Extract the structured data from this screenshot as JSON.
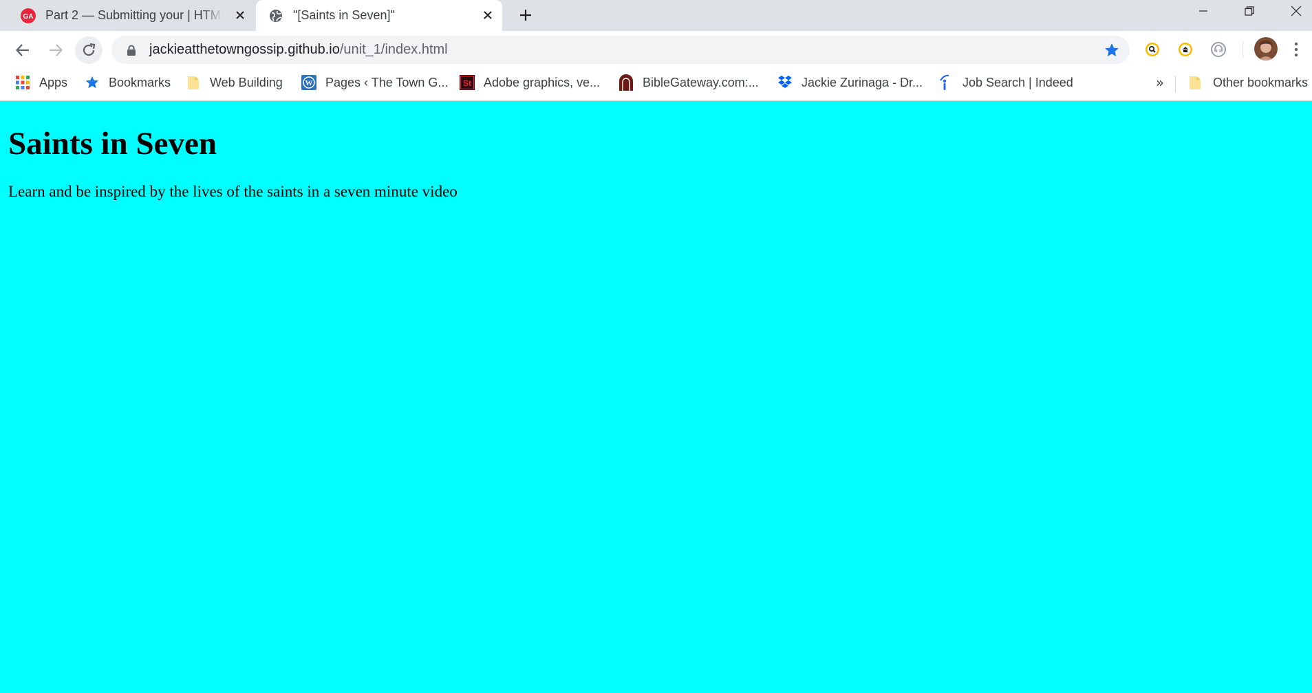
{
  "browser": {
    "tabs": [
      {
        "title": "Part 2 — Submitting your | HTML",
        "favicon": "ga-logo-icon",
        "active": false
      },
      {
        "title": "\"[Saints in Seven]\"",
        "favicon": "globe-icon",
        "active": true
      }
    ],
    "new_tab_label": "+",
    "address_bar": {
      "host": "jackieatthetowngossip.github.io",
      "path": "/unit_1/index.html"
    },
    "bookmarks": [
      {
        "label": "Apps",
        "icon": "apps-grid-icon"
      },
      {
        "label": "Bookmarks",
        "icon": "star-icon"
      },
      {
        "label": "Web Building",
        "icon": "folder-icon"
      },
      {
        "label": "Pages ‹ The Town G...",
        "icon": "wordpress-icon"
      },
      {
        "label": "Adobe graphics, ve...",
        "icon": "adobe-stock-icon"
      },
      {
        "label": "BibleGateway.com:...",
        "icon": "biblegateway-icon"
      },
      {
        "label": "Jackie Zurinaga - Dr...",
        "icon": "dropbox-icon"
      },
      {
        "label": "Job Search | Indeed",
        "icon": "indeed-icon"
      }
    ],
    "bookmarks_overflow": "»",
    "other_bookmarks": {
      "label": "Other bookmarks",
      "icon": "folder-icon"
    }
  },
  "page": {
    "heading": "Saints in Seven",
    "paragraph": "Learn and be inspired by the lives of the saints in a seven minute video",
    "background_color": "#00ffff"
  },
  "colors": {
    "tabstrip": "#dee1e6",
    "accent_blue": "#1a73e8",
    "ga_red": "#e8253c"
  }
}
